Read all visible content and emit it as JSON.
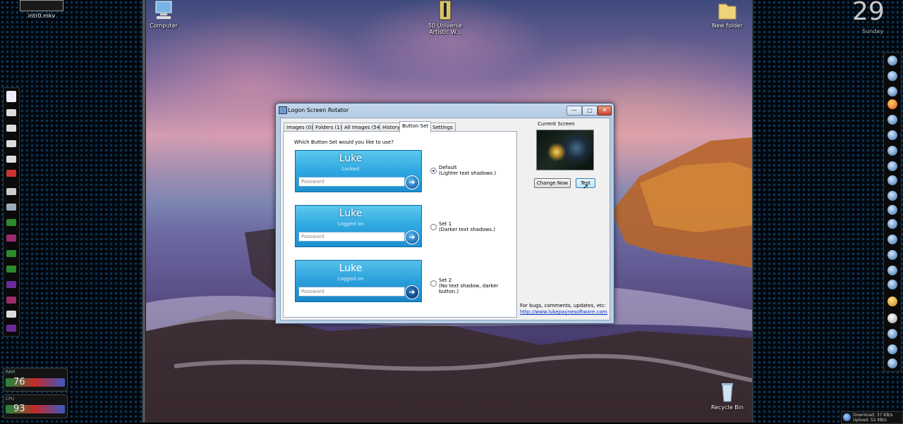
{
  "desktop": {
    "icons": [
      {
        "label": "intr0.mkv"
      },
      {
        "label": "Computer"
      },
      {
        "label": "50 Universe Artistic W..."
      },
      {
        "label": "New folder"
      },
      {
        "label": "Recycle Bin"
      }
    ]
  },
  "window": {
    "title": "Logon Screen Rotator",
    "controls": {
      "minimize": "—",
      "maximize": "□",
      "close": "✕"
    },
    "tabs": [
      {
        "label": "Images (0)"
      },
      {
        "label": "Folders (1)"
      },
      {
        "label": "All Images (54)"
      },
      {
        "label": "History"
      },
      {
        "label": "Button Set",
        "active": true
      },
      {
        "label": "Settings"
      }
    ],
    "question": "Which Button Set would you like to use?",
    "options": [
      {
        "name": "Luke",
        "status": "Locked",
        "password_placeholder": "Password",
        "title": "Default",
        "desc": "(Lighter text shadows.)",
        "selected": true
      },
      {
        "name": "Luke",
        "status": "Logged on",
        "password_placeholder": "Password",
        "title": "Set 1",
        "desc": "(Darker text shadows.)",
        "selected": false
      },
      {
        "name": "Luke",
        "status": "Logged on",
        "password_placeholder": "Password",
        "title": "Set 2",
        "desc": "(No text shadow, darker button.)",
        "selected": false
      }
    ],
    "current_screen_label": "Current Screen",
    "change_now_label": "Change Now",
    "test_label": "Test",
    "bugs_text": "For bugs, comments, updates, etc:",
    "link": "http://www.lukepaynesoftware.com/lsr"
  },
  "widgets": {
    "ram_label": "RAM",
    "ram_value": "76",
    "cpu_label": "CPU",
    "cpu_value": "93",
    "clock_day": "29",
    "clock_weekday": "Sunday",
    "download": "Download: 37 KB/s",
    "upload": "Upload: 52 KB/s"
  },
  "colors": {
    "accent": "#2ea7e0",
    "link": "#0033cc",
    "title_bar": "#b5cbe4"
  }
}
